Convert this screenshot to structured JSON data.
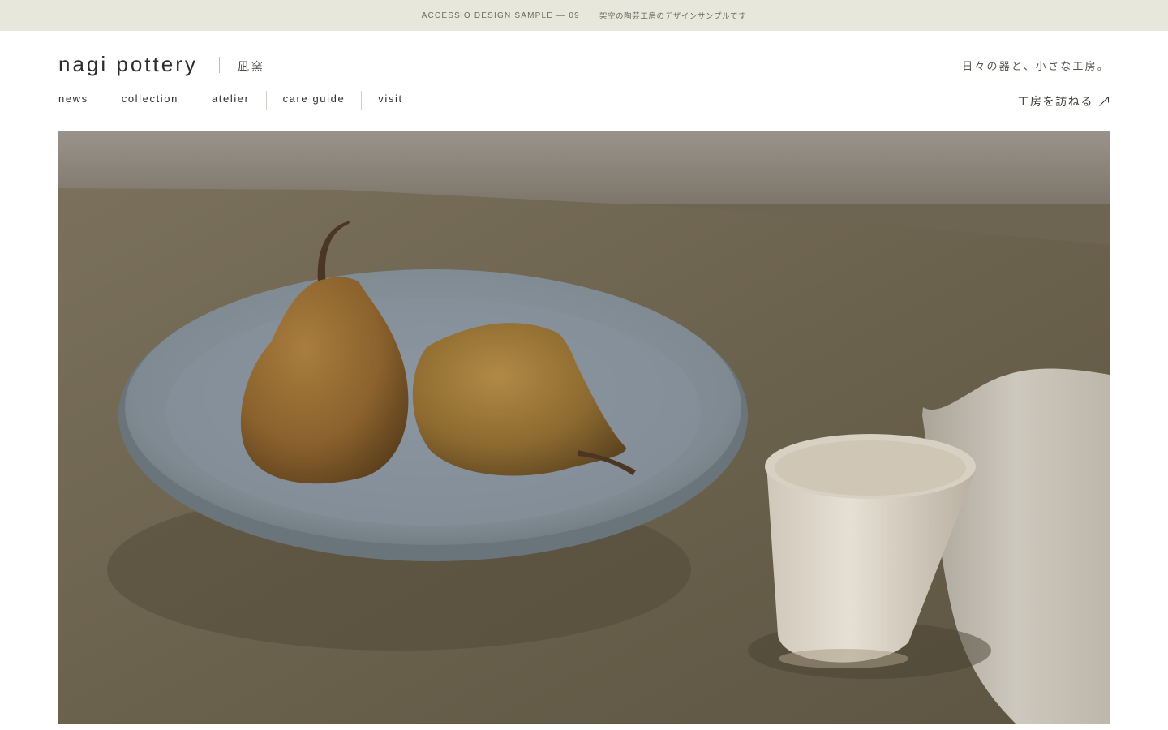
{
  "announcement": {
    "label": "ACCESSIO DESIGN SAMPLE — 09",
    "note": "架空の陶芸工房のデザインサンプルです"
  },
  "brand": {
    "name": "nagi pottery",
    "name_jp": "凪窯"
  },
  "tagline": "日々の器と、小さな工房。",
  "nav": {
    "items": [
      {
        "label": "news"
      },
      {
        "label": "collection"
      },
      {
        "label": "atelier"
      },
      {
        "label": "care guide"
      },
      {
        "label": "visit"
      }
    ]
  },
  "cta": {
    "label": "工房を訪ねる"
  },
  "hero": {
    "image_subject": "still life: two pears on a grey stoneware plate, white cup and linen cloth on a dark table",
    "icons": [
      "arrow-up-right-icon"
    ]
  },
  "colors": {
    "announcement_bg": "#e7e7dc",
    "text": "#2a2a28",
    "plate": "#8b96a0",
    "table": "#6d6551",
    "wall": "#a59c93"
  }
}
